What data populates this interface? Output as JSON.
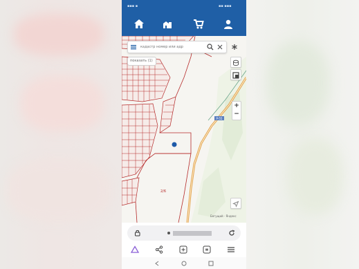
{
  "search": {
    "placeholder": "кадастр номер или адр"
  },
  "chip": {
    "label": "показать (1)"
  },
  "map": {
    "road_label": "Р-55",
    "plot_label": "2/6",
    "attribution": "Бегущий · Яндекс"
  },
  "colors": {
    "nav_blue": "#1f5fa6",
    "parcel_red": "#b52a2a",
    "road_orange": "#e2a24a",
    "marker_blue": "#1e5aa8"
  },
  "icons": {
    "nav": [
      "home-icon",
      "buildings-icon",
      "cart-icon",
      "user-icon"
    ],
    "browser": [
      "home-outline-icon",
      "share-icon",
      "new-tab-icon",
      "tabs-icon",
      "menu-icon"
    ],
    "system": [
      "back-icon",
      "home-circle-icon",
      "recents-icon"
    ]
  }
}
